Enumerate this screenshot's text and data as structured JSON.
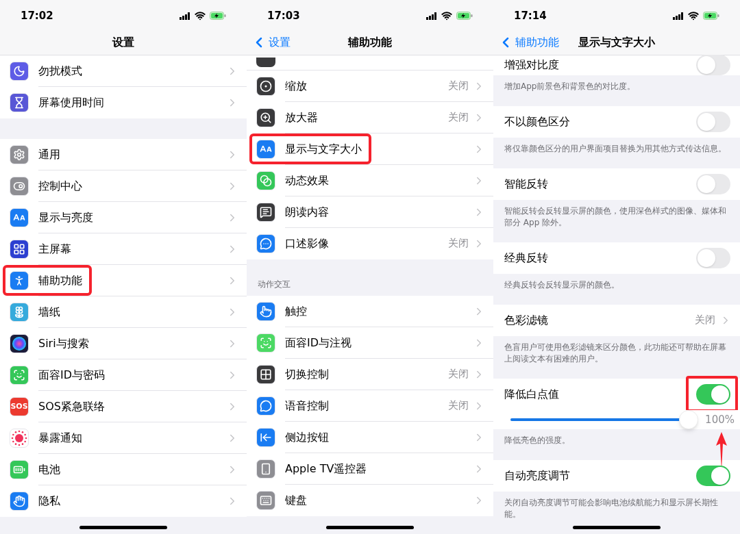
{
  "screens": [
    {
      "status": {
        "time": "17:02"
      },
      "nav": {
        "title": "设置"
      },
      "items": [
        {
          "kind": "link",
          "label": "勿扰模式",
          "color": "#5e5ce6",
          "highlighted": false
        },
        {
          "kind": "link",
          "label": "屏幕使用时间",
          "color": "#5856d6",
          "highlighted": false
        },
        {
          "kind": "gap"
        },
        {
          "kind": "link",
          "label": "通用",
          "color": "#8e8e93",
          "highlighted": false
        },
        {
          "kind": "link",
          "label": "控制中心",
          "color": "#8e8e93",
          "highlighted": false
        },
        {
          "kind": "link",
          "label": "显示与亮度",
          "color": "#1a7cf2",
          "highlighted": false
        },
        {
          "kind": "link",
          "label": "主屏幕",
          "color": "#2c3fd1",
          "highlighted": false
        },
        {
          "kind": "link",
          "label": "辅助功能",
          "color": "#1a7cf2",
          "highlighted": true
        },
        {
          "kind": "link",
          "label": "墙纸",
          "color": "#35aadc",
          "highlighted": false
        },
        {
          "kind": "link",
          "label": "Siri与搜索",
          "color": "#1c1c3a",
          "highlighted": false
        },
        {
          "kind": "link",
          "label": "面容ID与密码",
          "color": "#34c759",
          "highlighted": false
        },
        {
          "kind": "link",
          "label": "SOS紧急联络",
          "color": "#ec3a2f",
          "icon_text": "SOS",
          "highlighted": false
        },
        {
          "kind": "link",
          "label": "暴露通知",
          "color": "#ffffff",
          "highlighted": false
        },
        {
          "kind": "link",
          "label": "电池",
          "color": "#34c759",
          "highlighted": false
        },
        {
          "kind": "link",
          "label": "隐私",
          "color": "#1a7cf2",
          "highlighted": false
        }
      ]
    },
    {
      "status": {
        "time": "17:03"
      },
      "nav": {
        "back": "设置",
        "title": "辅助功能"
      },
      "items": [
        {
          "kind": "stub",
          "color": "#3a3a3c"
        },
        {
          "kind": "link",
          "label": "缩放",
          "value": "关闭",
          "color": "#3a3a3c",
          "highlighted": false
        },
        {
          "kind": "link",
          "label": "放大器",
          "value": "关闭",
          "color": "#3a3a3c",
          "highlighted": false
        },
        {
          "kind": "link",
          "label": "显示与文字大小",
          "color": "#1a7cf2",
          "highlighted": true
        },
        {
          "kind": "link",
          "label": "动态效果",
          "color": "#34c759",
          "highlighted": false
        },
        {
          "kind": "link",
          "label": "朗读内容",
          "color": "#3a3a3c",
          "highlighted": false
        },
        {
          "kind": "link",
          "label": "口述影像",
          "value": "关闭",
          "color": "#1a7cf2",
          "highlighted": false
        },
        {
          "kind": "header",
          "text": "动作交互"
        },
        {
          "kind": "link",
          "label": "触控",
          "color": "#1a7cf2",
          "highlighted": false
        },
        {
          "kind": "link",
          "label": "面容ID与注视",
          "color": "#4cd964",
          "highlighted": false
        },
        {
          "kind": "link",
          "label": "切换控制",
          "value": "关闭",
          "color": "#3a3a3c",
          "highlighted": false
        },
        {
          "kind": "link",
          "label": "语音控制",
          "value": "关闭",
          "color": "#1a7cf2",
          "highlighted": false
        },
        {
          "kind": "link",
          "label": "侧边按钮",
          "color": "#1a7cf2",
          "highlighted": false
        },
        {
          "kind": "link",
          "label": "Apple TV遥控器",
          "color": "#8e8e93",
          "highlighted": false
        },
        {
          "kind": "link",
          "label": "键盘",
          "color": "#8e8e93",
          "highlighted": false
        }
      ]
    },
    {
      "status": {
        "time": "17:14"
      },
      "nav": {
        "back": "辅助功能",
        "title": "显示与文字大小"
      },
      "items": [
        {
          "kind": "toggle",
          "label": "增强对比度",
          "on": false,
          "highlighted": false,
          "compact": true
        },
        {
          "kind": "footer",
          "text": "增加App前景色和背景色的对比度。"
        },
        {
          "kind": "toggle",
          "label": "不以颜色区分",
          "on": false,
          "highlighted": false
        },
        {
          "kind": "footer",
          "text": "将仅靠颜色区分的用户界面项目替换为用其他方式传达信息。"
        },
        {
          "kind": "toggle",
          "label": "智能反转",
          "on": false,
          "highlighted": false
        },
        {
          "kind": "footer",
          "text": "智能反转会反转显示屏的颜色，使用深色样式的图像、媒体和部分 App 除外。"
        },
        {
          "kind": "toggle",
          "label": "经典反转",
          "on": false,
          "highlighted": false
        },
        {
          "kind": "footer",
          "text": "经典反转会反转显示屏的颜色。"
        },
        {
          "kind": "link",
          "label": "色彩滤镜",
          "value": "关闭",
          "highlighted": false
        },
        {
          "kind": "footer",
          "text": "色盲用户可使用色彩滤镜来区分颜色，此功能还可帮助在屏幕上阅读文本有困难的用户。"
        },
        {
          "kind": "toggle",
          "label": "降低白点值",
          "on": true,
          "highlighted": true
        },
        {
          "kind": "slider",
          "level": 1,
          "reading": "100%",
          "arrow": true
        },
        {
          "kind": "footer",
          "text": "降低亮色的强度。"
        },
        {
          "kind": "toggle",
          "label": "自动亮度调节",
          "on": true,
          "highlighted": false
        },
        {
          "kind": "footer",
          "text": "关闭自动亮度调节可能会影响电池续航能力和显示屏长期性能。"
        }
      ]
    }
  ]
}
